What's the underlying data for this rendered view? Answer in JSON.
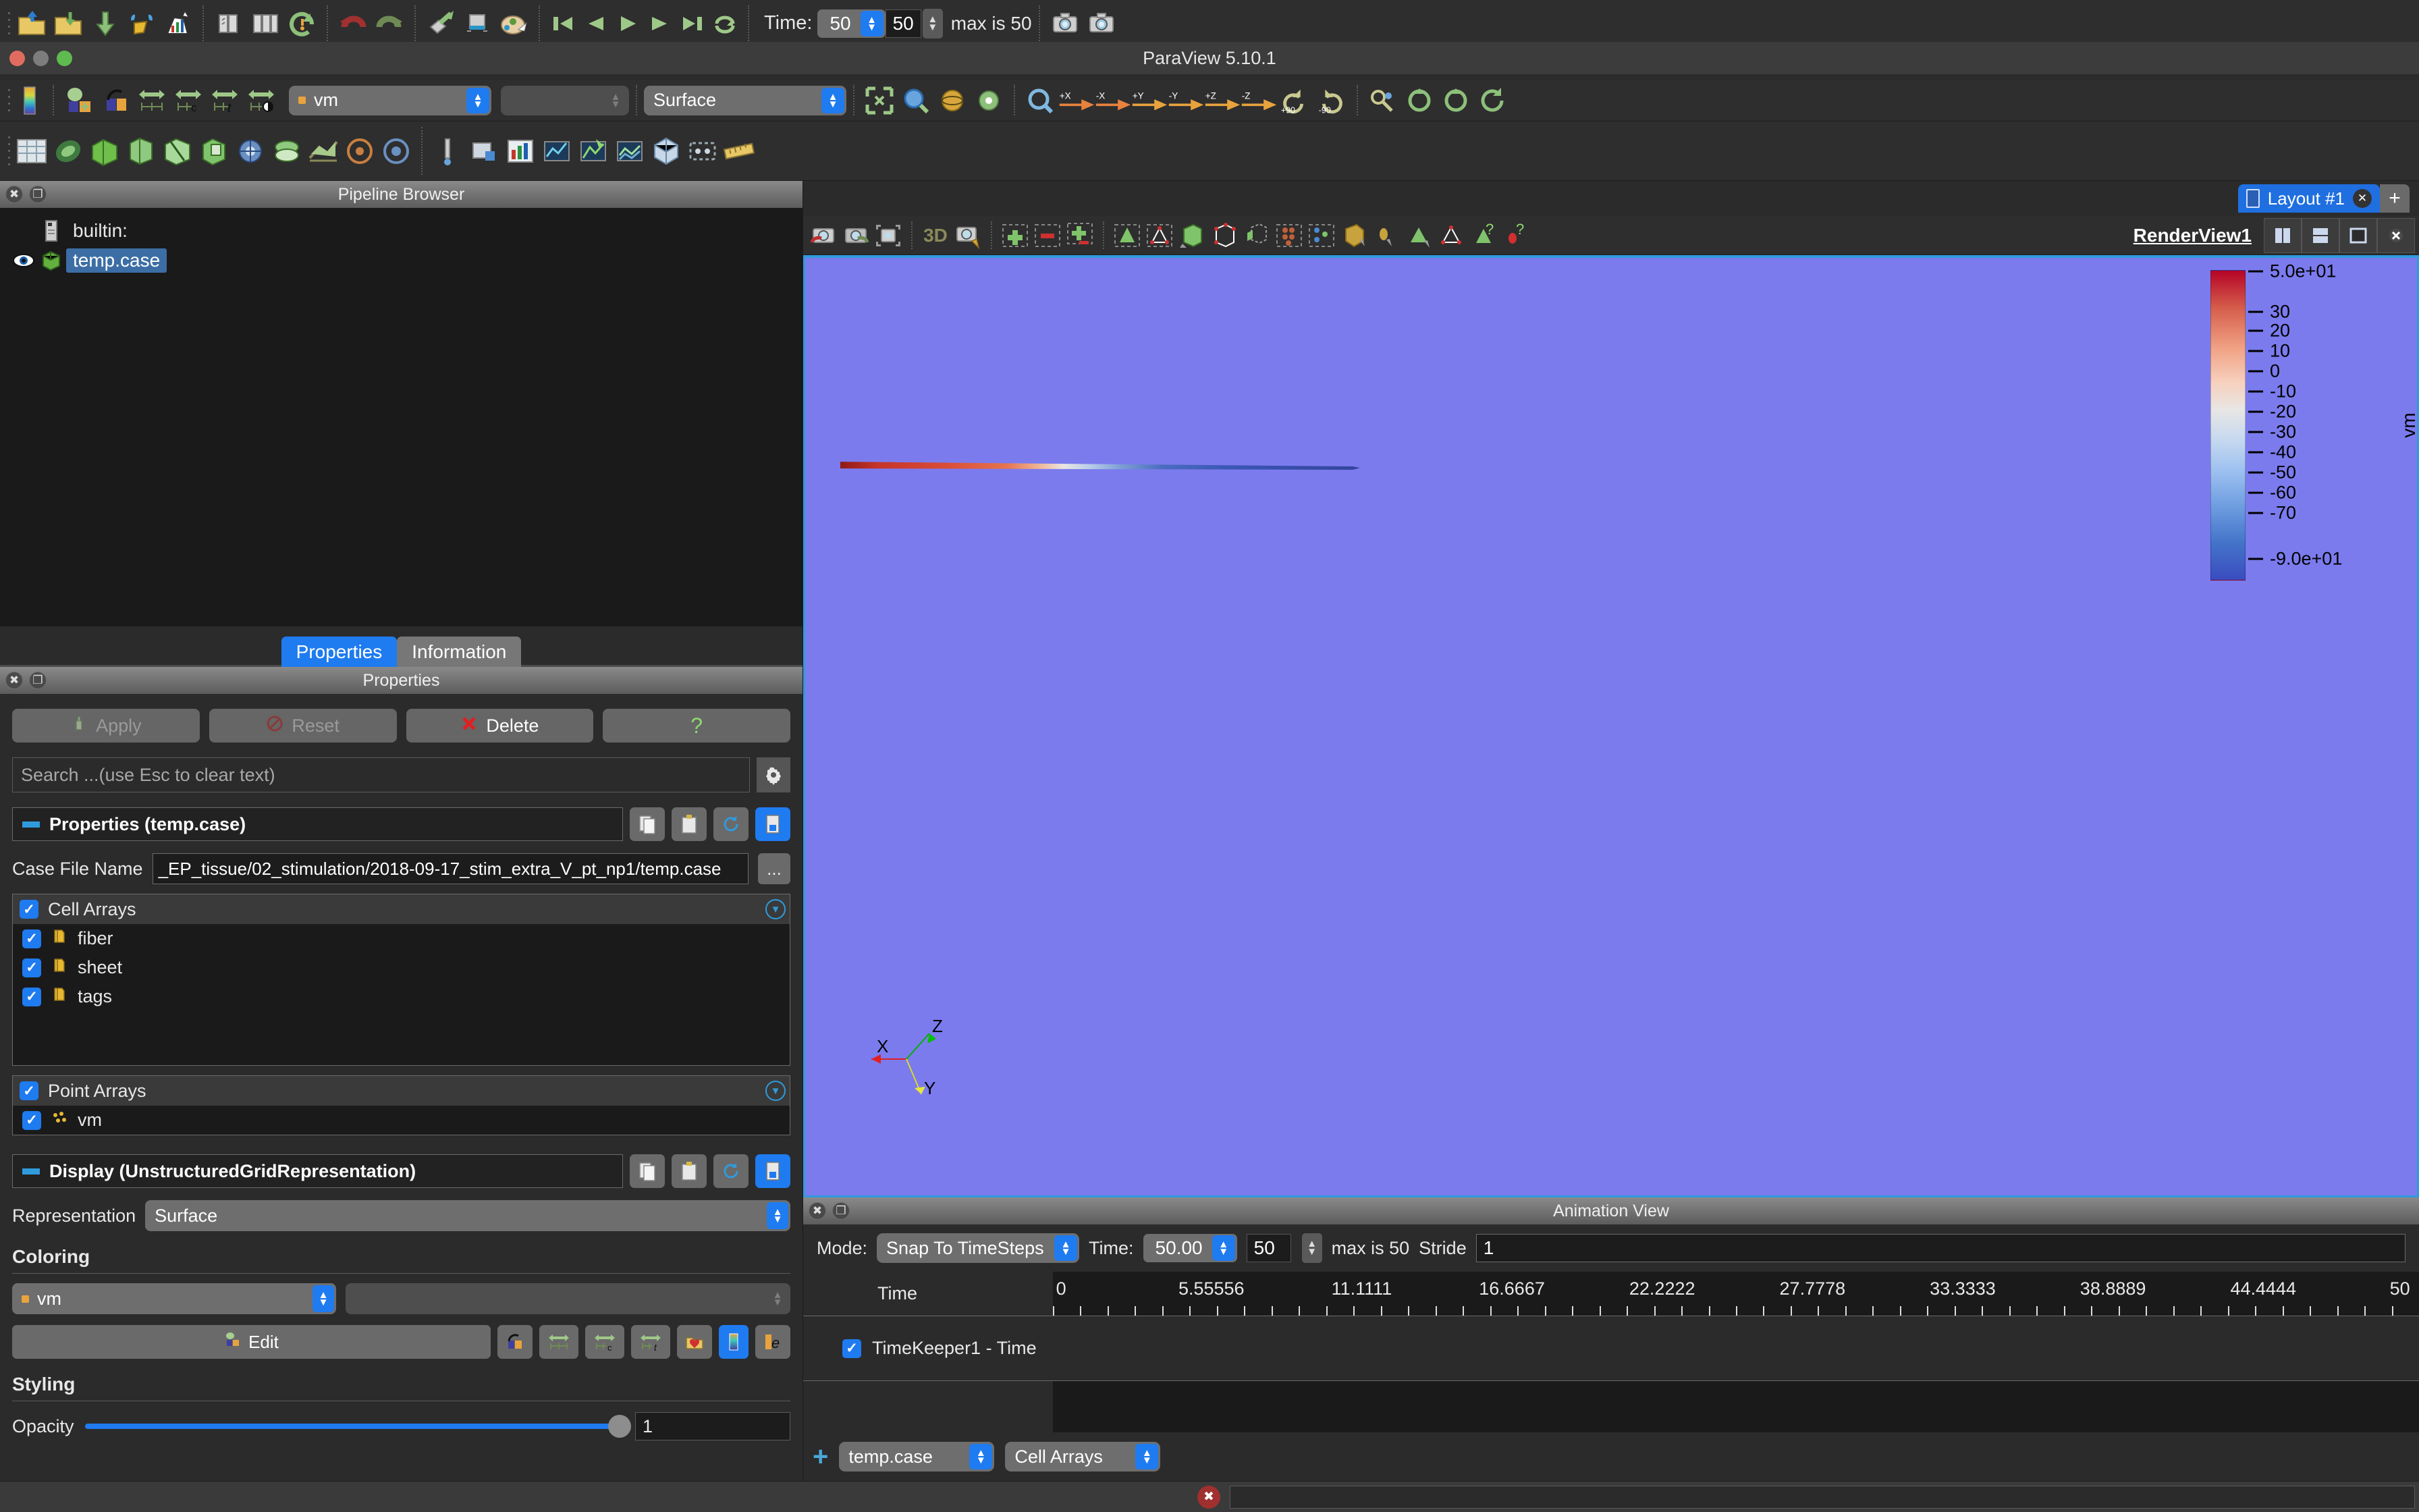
{
  "app": {
    "title": "ParaView 5.10.1"
  },
  "toolbar_time": {
    "label": "Time:",
    "time_value": "50",
    "frame_value": "50",
    "max_text": "max is 50"
  },
  "toolbar_arrays": {
    "color_by": "vm",
    "component": "",
    "representation": "Surface"
  },
  "pipeline": {
    "panel_title": "Pipeline Browser",
    "items": [
      {
        "label": "builtin:",
        "selected": false,
        "icon": "server-icon"
      },
      {
        "label": "temp.case",
        "selected": true,
        "icon": "green-cube-icon"
      }
    ]
  },
  "tabs": [
    {
      "label": "Properties",
      "active": true
    },
    {
      "label": "Information",
      "active": false
    }
  ],
  "properties": {
    "panel_title": "Properties",
    "buttons": [
      {
        "label": "Apply",
        "enabled": false,
        "icon": "apply-icon"
      },
      {
        "label": "Reset",
        "enabled": false,
        "icon": "reset-icon"
      },
      {
        "label": "Delete",
        "enabled": true,
        "icon": "delete-icon"
      },
      {
        "label": "?",
        "enabled": true,
        "icon": "help-icon"
      }
    ],
    "search_placeholder": "Search ...(use Esc to clear text)",
    "section_properties": "Properties (temp.case)",
    "case_file_label": "Case File Name",
    "case_file_value": "_EP_tissue/02_stimulation/2018-09-17_stim_extra_V_pt_np1/temp.case",
    "ellipsis_label": "...",
    "cell_arrays_label": "Cell Arrays",
    "cell_arrays": [
      {
        "label": "fiber",
        "checked": true
      },
      {
        "label": "sheet",
        "checked": true
      },
      {
        "label": "tags",
        "checked": true
      }
    ],
    "point_arrays_label": "Point Arrays",
    "point_arrays": [
      {
        "label": "vm",
        "checked": true
      }
    ],
    "section_display": "Display (UnstructuredGridRepresentation)",
    "representation_label": "Representation",
    "representation_value": "Surface",
    "coloring_label": "Coloring",
    "coloring_array": "vm",
    "coloring_component": "",
    "edit_label": "Edit",
    "styling_label": "Styling",
    "opacity_label": "Opacity",
    "opacity_value": "1"
  },
  "layout": {
    "tab_label": "Layout #1",
    "close_label": "✕",
    "add_label": "+"
  },
  "view": {
    "name": "RenderView1",
    "mode_3d_label": "3D"
  },
  "legend": {
    "title": "vm",
    "max_label": "5.0e+01",
    "min_label": "-9.0e+01",
    "ticks": [
      "30",
      "20",
      "10",
      "0",
      "-10",
      "-20",
      "-30",
      "-40",
      "-50",
      "-60",
      "-70"
    ]
  },
  "axes": {
    "x": "X",
    "y": "Y",
    "z": "Z"
  },
  "animation": {
    "panel_title": "Animation View",
    "mode_label": "Mode:",
    "mode_value": "Snap To TimeSteps",
    "time_label": "Time:",
    "time_value": "50.00",
    "frame_value": "50",
    "max_text": "max is 50",
    "stride_label": "Stride",
    "stride_value": "1",
    "time_column_header": "Time",
    "track_label": "TimeKeeper1 - Time",
    "track_checked": true,
    "source_value": "temp.case",
    "property_value": "Cell Arrays",
    "add_label": "+",
    "remove_label": "−",
    "tick_labels": [
      "0",
      "5.55556",
      "11.1111",
      "16.6667",
      "22.2222",
      "27.7778",
      "33.3333",
      "38.8889",
      "44.4444",
      "50"
    ]
  },
  "colors": {
    "accent_blue": "#1f7bf0",
    "render_bg": "#7b7bee",
    "dock_border": "#2f9bdd",
    "warm_max": "#b40426",
    "cool_min": "#3b4cc0"
  }
}
